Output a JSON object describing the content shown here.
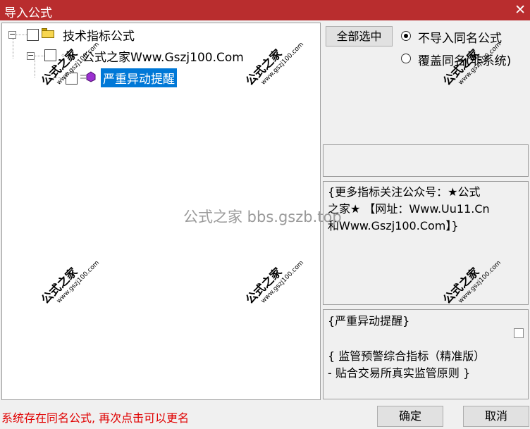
{
  "window": {
    "title": "导入公式",
    "close_glyph": "✕"
  },
  "tree": {
    "root_label": "技术指标公式",
    "child_label": "公式之家Www.Gszj100.Com",
    "leaf_label": "严重异动提醒",
    "expander_glyph": "−"
  },
  "side": {
    "select_all_label": "全部选中",
    "radio_no_import": "不导入同名公式",
    "radio_overwrite": "覆盖同名(非系统)",
    "info_text_1": "{更多指标关注公众号：★公式",
    "info_text_2": "之家★ 【网址：Www.Uu11.Cn",
    "info_text_3": "和Www.Gszj100.Com】}",
    "desc_line_1": "{严重异动提醒}",
    "desc_line_2": "{ 监管预警综合指标（精准版）",
    "desc_line_3": "- 贴合交易所真实监管原则 }"
  },
  "status_text": "系统存在同名公式, 再次点击可以更名",
  "buttons": {
    "ok": "确定",
    "cancel": "取消"
  },
  "watermark": {
    "text": "公式之家",
    "url": "www.gszj100.com",
    "center": "公式之家 bbs.gszb.top"
  }
}
